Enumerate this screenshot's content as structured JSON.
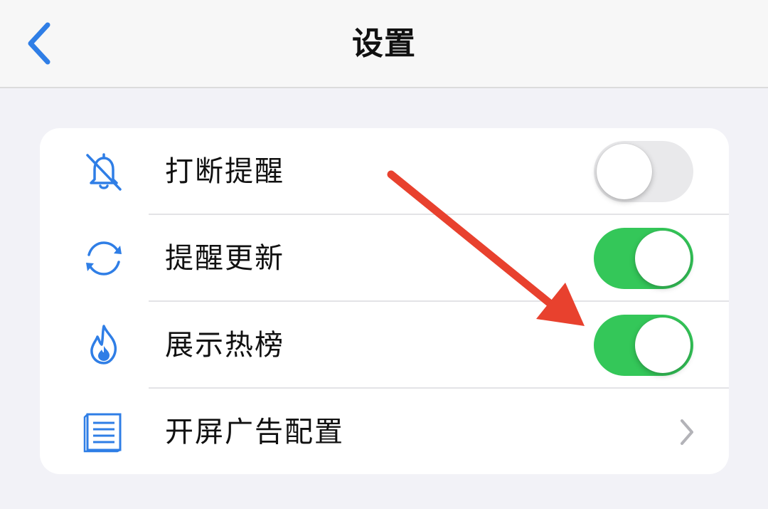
{
  "nav": {
    "title": "设置",
    "back_icon": "chevron-left-icon"
  },
  "colors": {
    "accent": "#2f7ee6",
    "toggle_on": "#34c759",
    "toggle_off": "#e9e9eb",
    "annotation": "#e8412e"
  },
  "settings": {
    "items": [
      {
        "label": "打断提醒",
        "icon": "bell-slash-icon",
        "control": "toggle",
        "on": false
      },
      {
        "label": "提醒更新",
        "icon": "refresh-icon",
        "control": "toggle",
        "on": true
      },
      {
        "label": "展示热榜",
        "icon": "flame-icon",
        "control": "toggle",
        "on": true
      },
      {
        "label": "开屏广告配置",
        "icon": "document-list-icon",
        "control": "chevron"
      }
    ]
  }
}
